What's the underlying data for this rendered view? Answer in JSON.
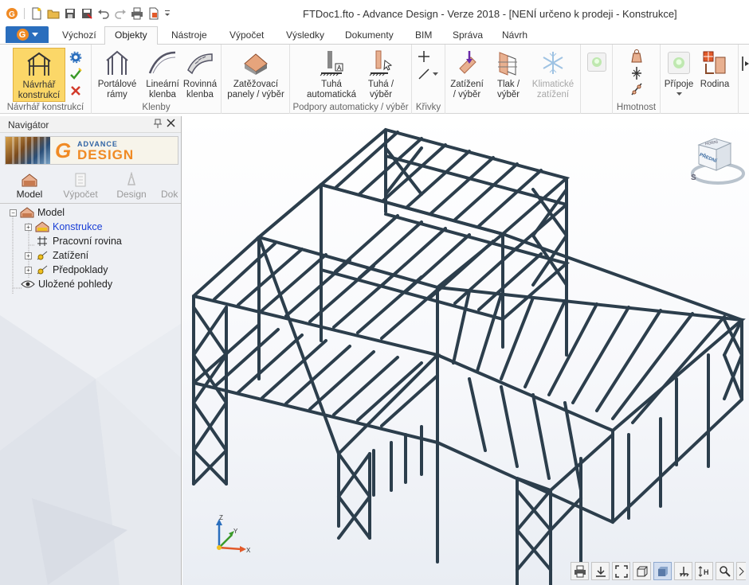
{
  "window": {
    "title": "FTDoc1.fto - Advance Design - Verze 2018 - [NENÍ určeno k prodeji - Konstrukce]"
  },
  "tabs": [
    {
      "label": "Výchozí"
    },
    {
      "label": "Objekty"
    },
    {
      "label": "Nástroje"
    },
    {
      "label": "Výpočet"
    },
    {
      "label": "Výsledky"
    },
    {
      "label": "Dokumenty"
    },
    {
      "label": "BIM"
    },
    {
      "label": "Správa"
    },
    {
      "label": "Návrh"
    }
  ],
  "ribbon": {
    "groups": [
      {
        "label": "Návrhář konstrukcí"
      },
      {
        "label": "Klenby"
      },
      {
        "label": "Podpory automaticky / výběr"
      },
      {
        "label": "Křivky"
      },
      {
        "label": "Hmotnost"
      }
    ],
    "buttons": {
      "designer": "Návrhář konstrukcí",
      "portal": "Portálové rámy",
      "linear_vault": "Lineární klenba",
      "planar_vault": "Rovinná klenba",
      "load_panels": "Zatěžovací panely / výběr",
      "rigid_auto": "Tuhá automatická",
      "rigid_select": "Tuhá / výběr",
      "loads_select": "Zatížení / výběr",
      "pressure_select": "Tlak / výběr",
      "climatic": "Klimatické zatížení",
      "connections": "Přípoje",
      "family": "Rodina"
    },
    "active_tab": "Objekty"
  },
  "navigator": {
    "title": "Navigátor",
    "logo": {
      "advance": "ADVANCE",
      "design": "DESIGN"
    },
    "tabs": [
      {
        "label": "Model",
        "enabled": true
      },
      {
        "label": "Výpočet",
        "enabled": false
      },
      {
        "label": "Design",
        "enabled": false
      },
      {
        "label": "Dok",
        "enabled": false
      }
    ],
    "tree": [
      {
        "label": "Model"
      },
      {
        "label": "Konstrukce"
      },
      {
        "label": "Pracovní rovina"
      },
      {
        "label": "Zatížení"
      },
      {
        "label": "Předpoklady"
      },
      {
        "label": "Uložené pohledy"
      }
    ]
  },
  "viewport": {
    "viewcube_face": "PŘEDNÍ",
    "viewcube_top": "HORNÍ",
    "compass": "S",
    "axes": {
      "x": "X",
      "y": "Y",
      "z": "Z"
    }
  },
  "colors": {
    "accent": "#2a6ebd",
    "brand_orange": "#f08a24",
    "selected_button": "#fbd768",
    "beam": "#2c3e4c",
    "link": "#1a3fd6"
  }
}
